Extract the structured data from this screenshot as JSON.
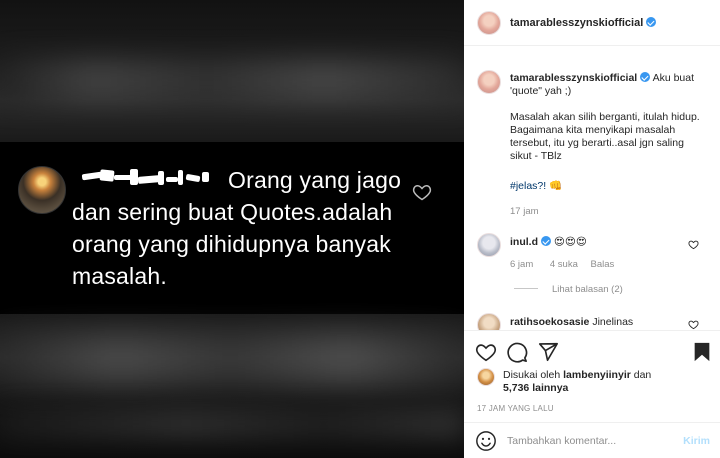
{
  "post": {
    "username": "tamarablesszynskiofficial",
    "verified": true,
    "caption_intro": "Aku buat 'quote\" yah ;)",
    "caption_body": "Masalah akan silih berganti, itulah hidup. Bagaimana kita menyikapi masalah tersebut, itu yg berarti..asal jgn saling sikut - TBlz",
    "hashtag": "#jelas?!",
    "hashtag_emoji": "👊",
    "caption_time": "17 jam"
  },
  "image_comment": {
    "text": "Orang yang jago dan sering buat Quotes.adalah orang yang dihidupnya banyak masalah."
  },
  "comments": [
    {
      "username": "inul.d",
      "verified": true,
      "text": "😍😍😍",
      "time": "6 jam",
      "likes": "4 suka",
      "reply_label": "Balas",
      "view_replies": "Lihat balasan (2)"
    },
    {
      "username": "ratihsoekosasie",
      "text": "Jinelinas"
    }
  ],
  "likes": {
    "liked_by_prefix": "Disukai oleh",
    "liked_by_user": "lambenyiinyir",
    "and": "dan",
    "others": "5,736 lainnya"
  },
  "timestamp": "17 JAM YANG LALU",
  "comment_box": {
    "placeholder": "Tambahkan komentar...",
    "submit_label": "Kirim"
  },
  "icons": {
    "like": "heart-icon",
    "comment": "comment-icon",
    "share": "share-icon",
    "save": "bookmark-icon",
    "emoji": "smiley-icon"
  },
  "colors": {
    "verified": "#3897f0",
    "text": "#262626",
    "secondary": "#8e8e8e",
    "hashtag": "#00376b",
    "submit_disabled": "#b2dffc"
  }
}
